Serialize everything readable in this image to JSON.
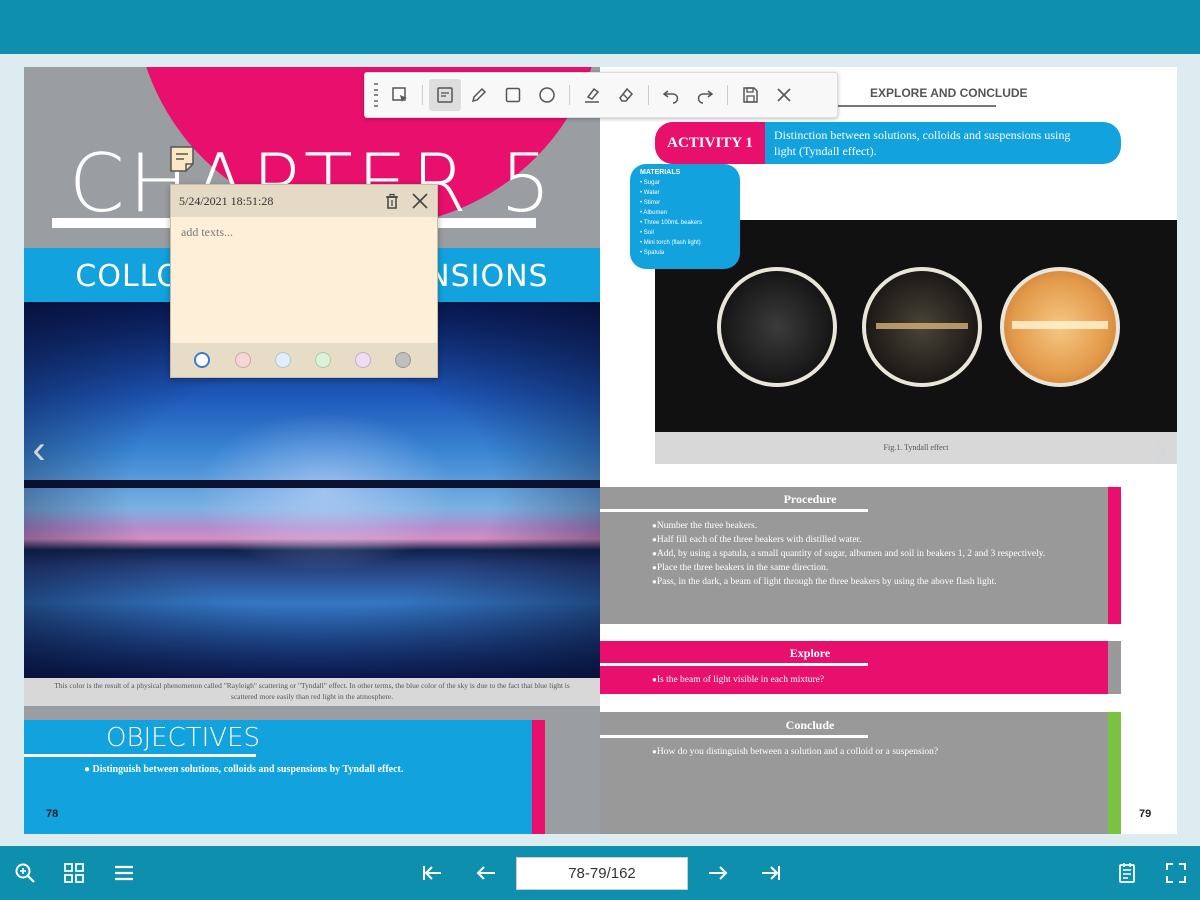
{
  "viewer": {
    "page_indicator": "78-79/162",
    "left_page_number": "78",
    "right_page_number": "79"
  },
  "left_page": {
    "chapter_title": "CHAPTER 5",
    "band_text": "COLLOIDS AND SUSPENSIONS",
    "caption": "This color is the result of a physical phenomenon called \"Rayleigh\" scattering or \"Tyndall\" effect. In other terms, the blue color of the sky is due to the fact that blue light is scattered more easily than red light in the atmosphere.",
    "objectives_title": "OBJECTIVES",
    "objective": "Distinguish between solutions, colloids and suspensions by Tyndall effect."
  },
  "right_page": {
    "header": "EXPLORE AND CONCLUDE",
    "activity_label": "ACTIVITY 1",
    "activity_title": "Distinction between solutions, colloids and suspensions using light (Tyndall effect).",
    "materials_title": "MATERIALS",
    "materials": [
      "Sugar",
      "Water",
      "Stirrer",
      "Albumen",
      "Three 100mL beakers",
      "Soil",
      "Mini torch (flash light)",
      "Spatula"
    ],
    "figure_caption": "Fig.1. Tyndall effect",
    "procedure_title": "Procedure",
    "procedure": [
      "Number the three beakers.",
      "Half fill each of the three beakers with distilled water.",
      "Add, by using a spatula, a small quantity of sugar, albumen and soil in beakers 1, 2 and 3 respectively.",
      "Place the three beakers in the same direction.",
      "Pass, in the dark, a beam of light through the three beakers by using the above flash light."
    ],
    "explore_title": "Explore",
    "explore": [
      "Is the beam of light visible in each mixture?"
    ],
    "conclude_title": "Conclude",
    "conclude": [
      "How do you distinguish between a solution and a colloid or a suspension?"
    ]
  },
  "note": {
    "timestamp": "5/24/2021 18:51:28",
    "placeholder": "add texts...",
    "swatch_colors": [
      "#ffffff",
      "#f6d6d6",
      "#dfeef8",
      "#dbf1d9",
      "#eedcf0",
      "#bfbfbf"
    ]
  },
  "colors": {
    "top_bar": "#0e8fad",
    "accent_blue": "#12a2de",
    "accent_pink": "#e8106c",
    "section_grey": "#999999",
    "conclude_green": "#7bc142"
  },
  "toolbar_icons": [
    "grip-icon",
    "select-icon",
    "note-icon",
    "pencil-icon",
    "rectangle-icon",
    "circle-icon",
    "highlighter-icon",
    "eraser-icon",
    "undo-icon",
    "redo-icon",
    "save-icon",
    "close-icon"
  ],
  "bottom_icons": [
    "zoom-icon",
    "thumbnails-icon",
    "menu-icon",
    "first-page-icon",
    "prev-page-icon",
    "next-page-icon",
    "last-page-icon",
    "notes-list-icon",
    "fullscreen-icon"
  ]
}
